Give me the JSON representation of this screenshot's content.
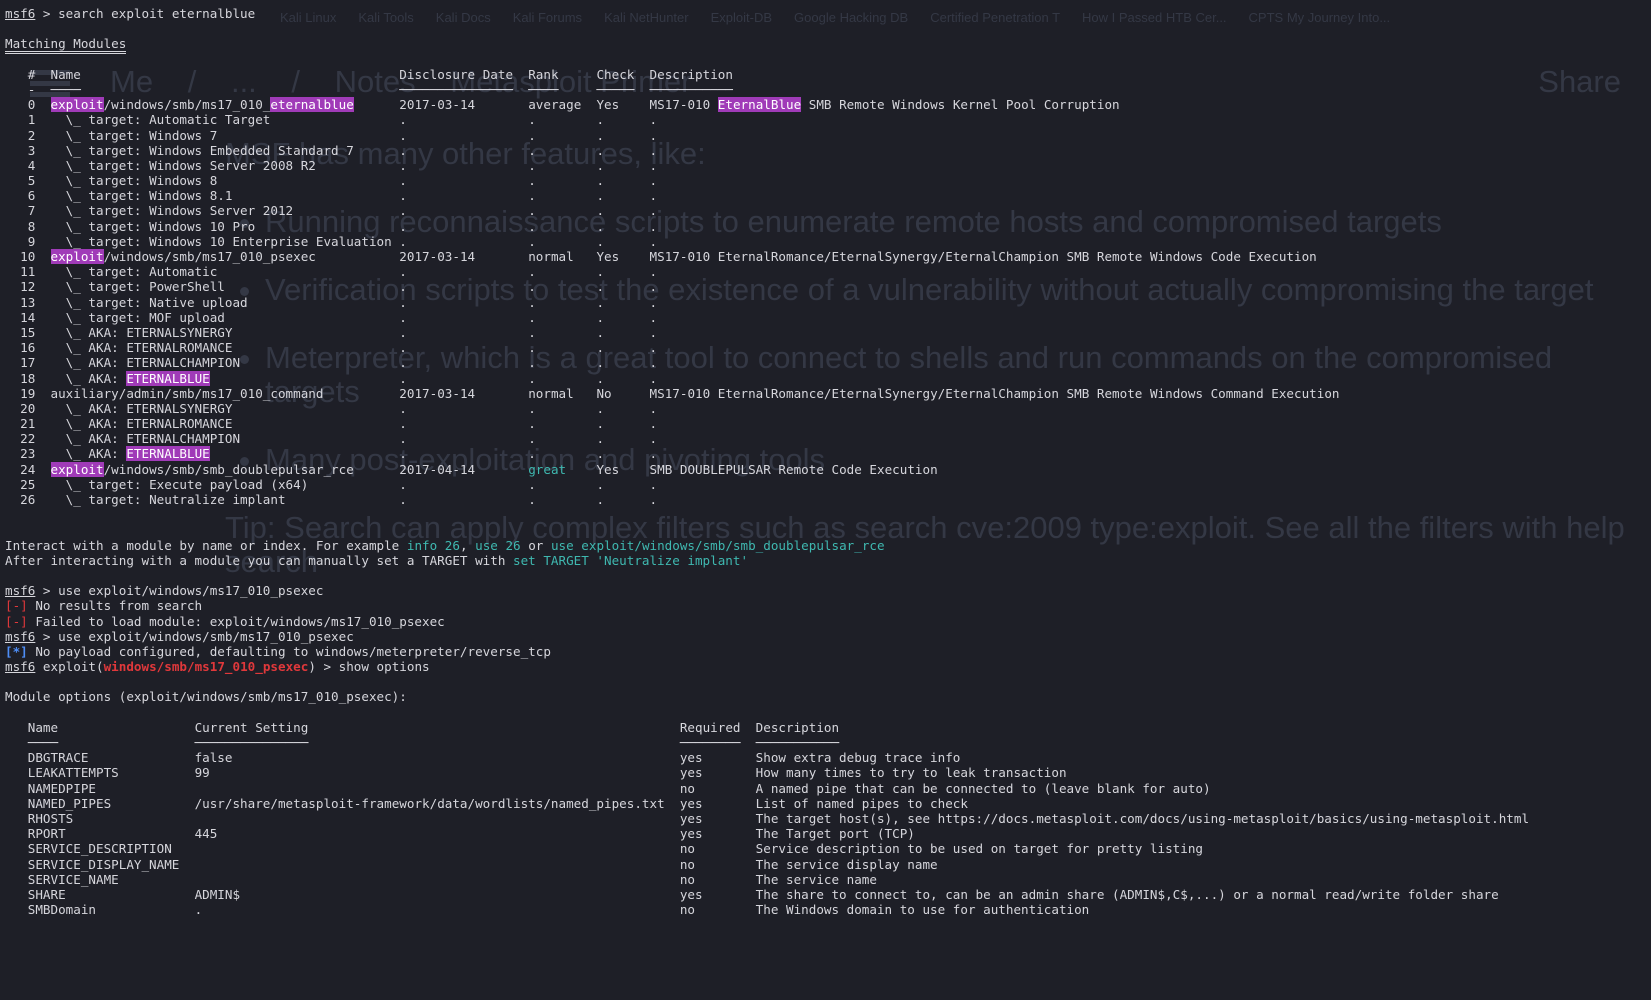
{
  "background": {
    "bookmarks": [
      "Kali Linux",
      "Kali Tools",
      "Kali Docs",
      "Kali Forums",
      "Kali NetHunter",
      "Exploit-DB",
      "Google Hacking DB",
      "Certified Penetration T",
      "How I Passed HTB Cer...",
      "CPTS My Journey Into..."
    ],
    "nav": {
      "me": "Me",
      "sep1": "/",
      "ellipsis": "...",
      "sep2": "/",
      "notes": "Notes",
      "page": "Metasploit Primer",
      "share": "Share"
    },
    "article": {
      "intro": "MSF has many other features, like:",
      "bullets": [
        "Running reconnaissance scripts to enumerate remote hosts and compromised targets",
        "Verification scripts to test the existence of a vulnerability without actually compromising the target",
        "Meterpreter, which is a great tool to connect to shells and run commands on the compromised targets",
        "Many post-exploitation and pivoting tools"
      ],
      "tip": "Tip: Search can apply complex filters such as search cve:2009 type:exploit. See all the filters with help search"
    }
  },
  "terminal": {
    "prompt_name": "msf6",
    "cmd_search": " > search exploit eternalblue",
    "matching_title": "Matching Modules",
    "search_headers": {
      "num": "#",
      "name": "Name",
      "date": "Disclosure Date",
      "rank": "Rank",
      "check": "Check",
      "desc": "Description"
    },
    "rows": [
      {
        "n": "0",
        "hl": "exploit",
        "name": "/windows/smb/ms17_010_",
        "hl2": "eternalblue",
        "date": "2017-03-14",
        "rank": "average",
        "check": "Yes",
        "d_pre": "MS17-010 ",
        "d_hl": "EternalBlue",
        "d_post": " SMB Remote Windows Kernel Pool Corruption"
      },
      {
        "n": "1",
        "name": "  \\_ target: Automatic Target",
        "date": ".",
        "rank": ".",
        "check": ".",
        "d_post": "."
      },
      {
        "n": "2",
        "name": "  \\_ target: Windows 7",
        "date": ".",
        "rank": ".",
        "check": ".",
        "d_post": "."
      },
      {
        "n": "3",
        "name": "  \\_ target: Windows Embedded Standard 7",
        "date": ".",
        "rank": ".",
        "check": ".",
        "d_post": "."
      },
      {
        "n": "4",
        "name": "  \\_ target: Windows Server 2008 R2",
        "date": ".",
        "rank": ".",
        "check": ".",
        "d_post": "."
      },
      {
        "n": "5",
        "name": "  \\_ target: Windows 8",
        "date": ".",
        "rank": ".",
        "check": ".",
        "d_post": "."
      },
      {
        "n": "6",
        "name": "  \\_ target: Windows 8.1",
        "date": ".",
        "rank": ".",
        "check": ".",
        "d_post": "."
      },
      {
        "n": "7",
        "name": "  \\_ target: Windows Server 2012",
        "date": ".",
        "rank": ".",
        "check": ".",
        "d_post": "."
      },
      {
        "n": "8",
        "name": "  \\_ target: Windows 10 Pro",
        "date": ".",
        "rank": ".",
        "check": ".",
        "d_post": "."
      },
      {
        "n": "9",
        "name": "  \\_ target: Windows 10 Enterprise Evaluation",
        "date": ".",
        "rank": ".",
        "check": ".",
        "d_post": "."
      },
      {
        "n": "10",
        "hl": "exploit",
        "name": "/windows/smb/ms17_010_psexec",
        "date": "2017-03-14",
        "rank": "normal",
        "check": "Yes",
        "d_post": "MS17-010 EternalRomance/EternalSynergy/EternalChampion SMB Remote Windows Code Execution"
      },
      {
        "n": "11",
        "name": "  \\_ target: Automatic",
        "date": ".",
        "rank": ".",
        "check": ".",
        "d_post": "."
      },
      {
        "n": "12",
        "name": "  \\_ target: PowerShell",
        "date": ".",
        "rank": ".",
        "check": ".",
        "d_post": "."
      },
      {
        "n": "13",
        "name": "  \\_ target: Native upload",
        "date": ".",
        "rank": ".",
        "check": ".",
        "d_post": "."
      },
      {
        "n": "14",
        "name": "  \\_ target: MOF upload",
        "date": ".",
        "rank": ".",
        "check": ".",
        "d_post": "."
      },
      {
        "n": "15",
        "name": "  \\_ AKA: ETERNALSYNERGY",
        "date": ".",
        "rank": ".",
        "check": ".",
        "d_post": "."
      },
      {
        "n": "16",
        "name": "  \\_ AKA: ETERNALROMANCE",
        "date": ".",
        "rank": ".",
        "check": ".",
        "d_post": "."
      },
      {
        "n": "17",
        "name": "  \\_ AKA: ETERNALCHAMPION",
        "date": ".",
        "rank": ".",
        "check": ".",
        "d_post": "."
      },
      {
        "n": "18",
        "name": "  \\_ AKA: ",
        "hl2": "ETERNALBLUE",
        "date": ".",
        "rank": ".",
        "check": ".",
        "d_post": "."
      },
      {
        "n": "19",
        "name": "auxiliary/admin/smb/ms17_010_command",
        "date": "2017-03-14",
        "rank": "normal",
        "check": "No",
        "d_post": "MS17-010 EternalRomance/EternalSynergy/EternalChampion SMB Remote Windows Command Execution"
      },
      {
        "n": "20",
        "name": "  \\_ AKA: ETERNALSYNERGY",
        "date": ".",
        "rank": ".",
        "check": ".",
        "d_post": "."
      },
      {
        "n": "21",
        "name": "  \\_ AKA: ETERNALROMANCE",
        "date": ".",
        "rank": ".",
        "check": ".",
        "d_post": "."
      },
      {
        "n": "22",
        "name": "  \\_ AKA: ETERNALCHAMPION",
        "date": ".",
        "rank": ".",
        "check": ".",
        "d_post": "."
      },
      {
        "n": "23",
        "name": "  \\_ AKA: ",
        "hl2": "ETERNALBLUE",
        "date": ".",
        "rank": ".",
        "check": ".",
        "d_post": "."
      },
      {
        "n": "24",
        "hl": "exploit",
        "name": "/windows/smb/smb_doublepulsar_rce",
        "date": "2017-04-14",
        "rank": "great",
        "rank_green": true,
        "check": "Yes",
        "d_post": "SMB DOUBLEPULSAR Remote Code Execution"
      },
      {
        "n": "25",
        "name": "  \\_ target: Execute payload (x64)",
        "date": ".",
        "rank": ".",
        "check": ".",
        "d_post": "."
      },
      {
        "n": "26",
        "name": "  \\_ target: Neutralize implant",
        "date": ".",
        "rank": ".",
        "check": ".",
        "d_post": "."
      }
    ],
    "interact1_pre": "Interact with a module by name or index. For example ",
    "interact1_a": "info 26",
    "interact1_sep1": ", ",
    "interact1_b": "use 26",
    "interact1_sep2": " or ",
    "interact1_c": "use exploit/windows/smb/smb_doublepulsar_rce",
    "interact2_pre": "After interacting with a module you can manually set a TARGET with ",
    "interact2_a": "set TARGET 'Neutralize implant'",
    "cmd_use1": " > use exploit/windows/ms17_010_psexec",
    "err_tag": "[-]",
    "err1": " No results from search",
    "err2": " Failed to load module: exploit/windows/ms17_010_psexec",
    "cmd_use2": " > use exploit/windows/smb/ms17_010_psexec",
    "info_tag": "[*]",
    "info1": " No payload configured, defaulting to windows/meterpreter/reverse_tcp",
    "exploit_prefix": " exploit(",
    "exploit_module": "windows/smb/ms17_010_psexec",
    "exploit_cmd": ") > show options",
    "options_title": "Module options (exploit/windows/smb/ms17_010_psexec):",
    "opt_headers": {
      "name": "Name",
      "setting": "Current Setting",
      "required": "Required",
      "desc": "Description"
    },
    "options": [
      {
        "name": "DBGTRACE",
        "setting": "false",
        "required": "yes",
        "desc": "Show extra debug trace info"
      },
      {
        "name": "LEAKATTEMPTS",
        "setting": "99",
        "required": "yes",
        "desc": "How many times to try to leak transaction"
      },
      {
        "name": "NAMEDPIPE",
        "setting": "",
        "required": "no",
        "desc": "A named pipe that can be connected to (leave blank for auto)"
      },
      {
        "name": "NAMED_PIPES",
        "setting": "/usr/share/metasploit-framework/data/wordlists/named_pipes.txt",
        "required": "yes",
        "desc": "List of named pipes to check"
      },
      {
        "name": "RHOSTS",
        "setting": "",
        "required": "yes",
        "desc": "The target host(s), see https://docs.metasploit.com/docs/using-metasploit/basics/using-metasploit.html"
      },
      {
        "name": "RPORT",
        "setting": "445",
        "required": "yes",
        "desc": "The Target port (TCP)"
      },
      {
        "name": "SERVICE_DESCRIPTION",
        "setting": "",
        "required": "no",
        "desc": "Service description to be used on target for pretty listing"
      },
      {
        "name": "SERVICE_DISPLAY_NAME",
        "setting": "",
        "required": "no",
        "desc": "The service display name"
      },
      {
        "name": "SERVICE_NAME",
        "setting": "",
        "required": "no",
        "desc": "The service name"
      },
      {
        "name": "SHARE",
        "setting": "ADMIN$",
        "required": "yes",
        "desc": "The share to connect to, can be an admin share (ADMIN$,C$,...) or a normal read/write folder share"
      },
      {
        "name": "SMBDomain",
        "setting": ".",
        "required": "no",
        "desc": "The Windows domain to use for authentication"
      }
    ]
  }
}
